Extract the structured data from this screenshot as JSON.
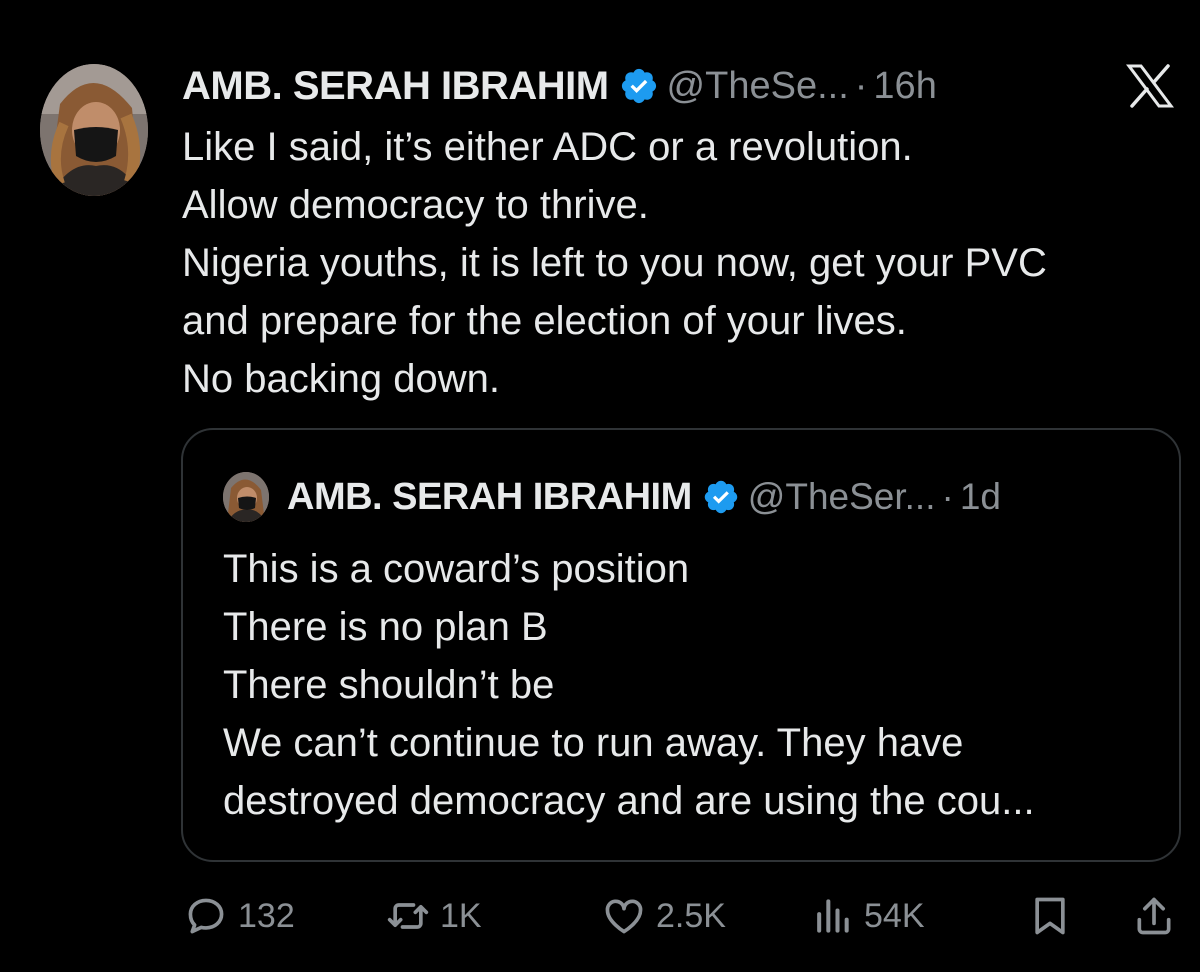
{
  "tweet": {
    "author_name": "AMB. SERAH IBRAHIM",
    "handle": "@TheSe...",
    "separator": "·",
    "time": "16h",
    "avatar_icon": "profile-photo",
    "text_lines": [
      "Like I said, it’s either ADC or a revolution.",
      "Allow democracy to thrive.",
      "Nigeria youths, it is left to you now, get your PVC",
      "and prepare for the election of your lives.",
      "No backing down."
    ]
  },
  "quoted_tweet": {
    "author_name": "AMB. SERAH IBRAHIM",
    "handle": "@TheSer...",
    "separator": "·",
    "time": "1d",
    "text_lines": [
      "This is a coward’s position",
      "There is no plan B",
      "There shouldn’t be",
      "We can’t continue to run away. They have",
      "destroyed democracy and are using the cou..."
    ]
  },
  "actions": {
    "replies": "132",
    "reposts": "1K",
    "likes": "2.5K",
    "views": "54K"
  },
  "colors": {
    "background": "#000000",
    "text": "#e7e9ea",
    "secondary": "#8b9095",
    "verified": "#1d9bf0",
    "border": "#2f3336"
  }
}
